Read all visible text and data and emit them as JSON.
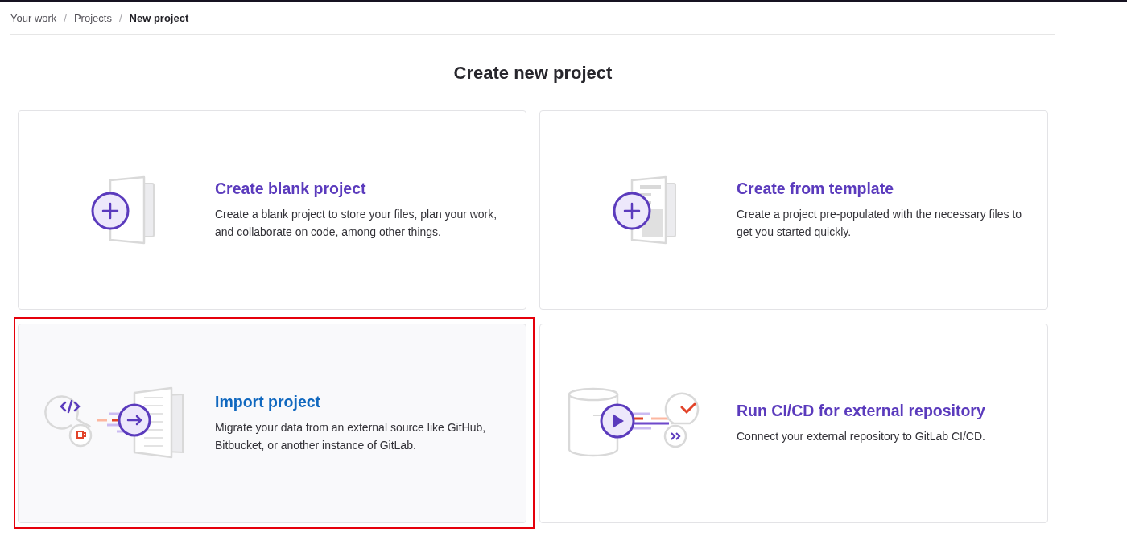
{
  "breadcrumbs": [
    {
      "label": "Your work",
      "current": false
    },
    {
      "label": "Projects",
      "current": false
    },
    {
      "label": "New project",
      "current": true
    }
  ],
  "breadcrumb_separator": "/",
  "title": "Create new project",
  "options": [
    {
      "kind": "blank",
      "title": "Create blank project",
      "description": "Create a blank project to store your files, plan your work, and collaborate on code, among other things.",
      "selected": false
    },
    {
      "kind": "template",
      "title": "Create from template",
      "description": "Create a project pre-populated with the necessary files to get you started quickly.",
      "selected": false
    },
    {
      "kind": "import",
      "title": "Import project",
      "description": "Migrate your data from an external source like GitHub, Bitbucket, or another instance of GitLab.",
      "selected": true
    },
    {
      "kind": "cicd",
      "title": "Run CI/CD for external repository",
      "description": "Connect your external repository to GitLab CI/CD.",
      "selected": false
    }
  ]
}
